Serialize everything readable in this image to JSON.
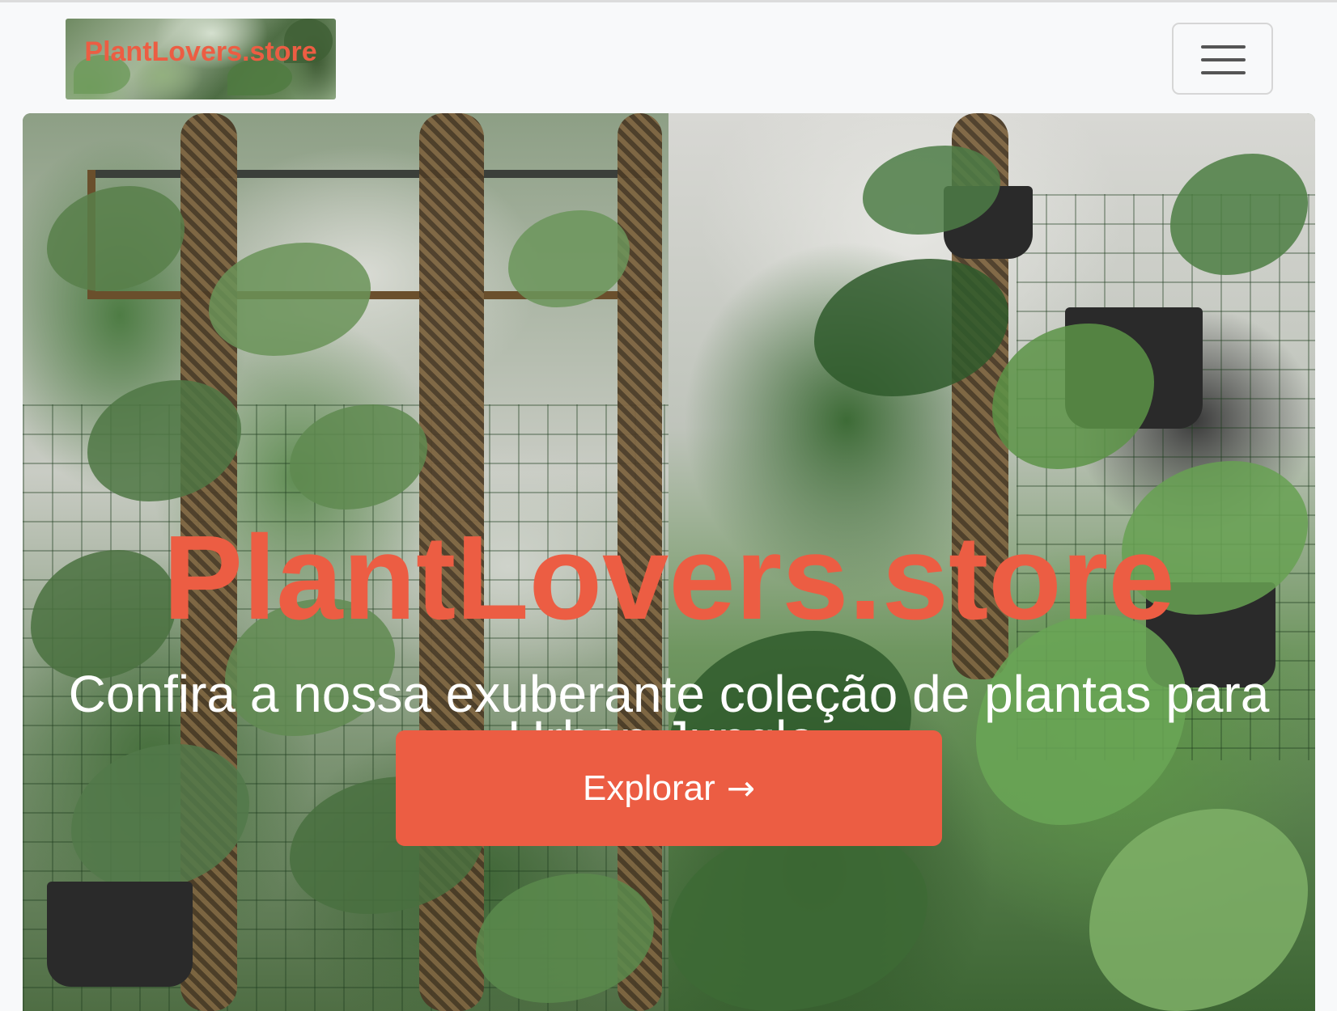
{
  "navbar": {
    "brand_text": "PlantLovers.store",
    "toggler_icon": "hamburger-menu-icon"
  },
  "hero": {
    "title": "PlantLovers.store",
    "subtitle": "Confira a nossa exuberante coleção de plantas para Urban Jungle.",
    "button_label": "Explorar",
    "button_icon": "arrow-right-icon",
    "button_arrow": "→"
  },
  "colors": {
    "accent": "#ec5d43",
    "navbar_bg": "#f8f9fa",
    "text_light": "#ffffff"
  }
}
